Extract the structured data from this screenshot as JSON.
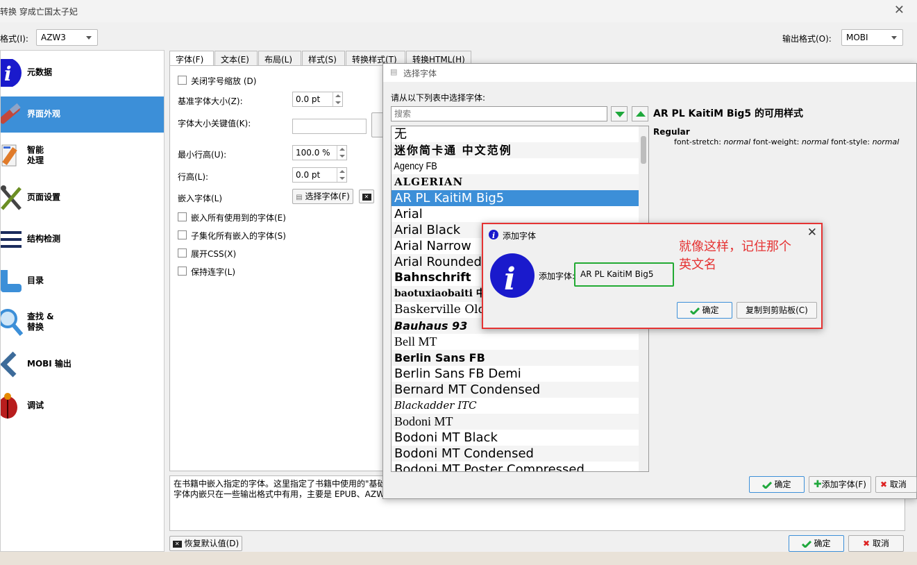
{
  "window": {
    "title": "转换 穿成亡国太子妃",
    "close": "✕"
  },
  "input_format": {
    "label": "格式(I):",
    "value": "AZW3"
  },
  "output_format": {
    "label": "输出格式(O):",
    "value": "MOBI"
  },
  "sidebar": {
    "items": [
      {
        "label": "元数据",
        "icon": "info-icon"
      },
      {
        "label": "界面外观",
        "icon": "brush-icon"
      },
      {
        "label": "智能\n处理",
        "icon": "magic-icon"
      },
      {
        "label": "页面设置",
        "icon": "tools-icon"
      },
      {
        "label": "结构检测",
        "icon": "structure-icon"
      },
      {
        "label": "目录",
        "icon": "toc-icon"
      },
      {
        "label": "查找 &\n替换",
        "icon": "search-icon"
      },
      {
        "label": "MOBI 输出",
        "icon": "mobi-icon"
      },
      {
        "label": "调试",
        "icon": "bug-icon"
      }
    ],
    "selected": 1
  },
  "tabs": [
    "字体(F)",
    "文本(E)",
    "布局(L)",
    "样式(S)",
    "转换样式(T)",
    "转换HTML(H)"
  ],
  "fonts_panel": {
    "disable_scaling": "关闭字号缩放 (D)",
    "base_size_label": "基准字体大小(Z):",
    "base_size_value": "0.0 pt",
    "key_label": "字体大小关键值(K):",
    "min_line_label": "最小行高(U):",
    "min_line_value": "100.0 %",
    "line_height_label": "行高(L):",
    "line_height_value": "0.0 pt",
    "embed_label": "嵌入字体(L)",
    "choose_font_btn": "选择字体(F)",
    "embed_all": "嵌入所有使用到的字体(E)",
    "subset": "子集化所有嵌入的字体(S)",
    "expand_css": "展开CSS(X)",
    "keep_ligatures": "保持连字(L)"
  },
  "help_text": {
    "line1": "在书籍中嵌入指定的字体。这里指定了书籍中使用的\"基础",
    "line2": "字体内嵌只在一些输出格式中有用，主要是 EPUB、AZW"
  },
  "bottom": {
    "restore": "恢复默认值(D)",
    "ok": "确定",
    "cancel": "取消"
  },
  "font_dialog": {
    "title": "选择字体",
    "prompt": "请从以下列表中选择字体:",
    "search_placeholder": "搜索",
    "styles_title": "AR PL KaitiM Big5 的可用样式",
    "style_name": "Regular",
    "style_detail_prefix1": "font-stretch: ",
    "style_detail_val1": "normal",
    "style_detail_prefix2": " font-weight: ",
    "style_detail_val2": "normal",
    "style_detail_prefix3": " font-style: ",
    "style_detail_val3": "normal",
    "fonts": [
      "无",
      "迷你简卡通 中文范例",
      "Agency FB",
      "ALGERIAN",
      "AR PL KaitiM Big5",
      "Arial",
      "Arial Black",
      "Arial Narrow",
      "Arial Rounded",
      "Bahnschrift",
      "baotuxiaobaiti 中",
      "Baskerville Old Fa",
      "Bauhaus 93",
      "Bell MT",
      "Berlin Sans FB",
      "Berlin Sans FB Demi",
      "Bernard MT Condensed",
      "Blackadder ITC",
      "Bodoni MT",
      "Bodoni MT Black",
      "Bodoni MT Condensed",
      "Bodoni MT Poster Compressed"
    ],
    "selected_index": 4,
    "ok": "确定",
    "add_font": "添加字体(F)",
    "cancel": "取消"
  },
  "info_dialog": {
    "title": "添加字体",
    "label": "添加字体:",
    "value": "AR PL KaitiM Big5",
    "ok": "确定",
    "copy": "复制到剪贴板(C)",
    "annotation": "就像这样，记住那个\n英文名"
  },
  "colors": {
    "accent": "#3c8fd8",
    "annotation": "#e53333",
    "highlight_box": "#22aa33"
  }
}
